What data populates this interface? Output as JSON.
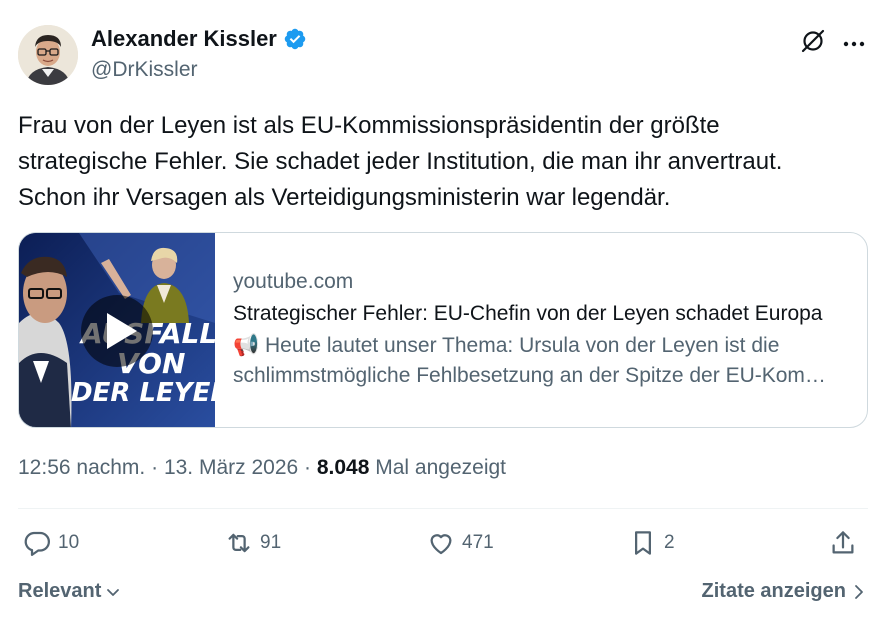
{
  "author": {
    "name": "Alexander Kissler",
    "handle": "@DrKissler",
    "verified_color": "#1d9bf0"
  },
  "tweet": {
    "lines": [
      "Frau von der Leyen ist als EU-Kommissionspräsidentin der größte",
      "strategische Fehler. Sie schadet jeder Institution, die man ihr anvertraut.",
      "Schon ihr Versagen als Verteidigungsministerin war legendär."
    ]
  },
  "card": {
    "domain": "youtube.com",
    "title": "Strategischer Fehler: EU-Chefin von der Leyen schadet Europa",
    "desc_line1": "📢 Heute lautet unser Thema: Ursula von der Leyen ist die",
    "desc_line2": "schlimmstmögliche Fehlbesetzung an der Spitze der EU-Kommission",
    "thumb_text_1": "AUSFALL",
    "thumb_text_2": "VON",
    "thumb_text_3": "DER LEYEN"
  },
  "meta": {
    "time": "12:56 nachm.",
    "sep1": " · ",
    "date": "13. März 2026",
    "sep2": " · ",
    "views": "8.048",
    "views_label": " Mal angezeigt"
  },
  "actions": {
    "replies": "10",
    "reposts": "91",
    "likes": "471",
    "bookmarks": "2"
  },
  "footer": {
    "sort_label": "Relevant",
    "quotes_label": "Zitate anzeigen"
  },
  "icons": {
    "grok": "grok-icon",
    "more": "more-icon",
    "reply": "reply-icon",
    "repost": "repost-icon",
    "like": "like-icon",
    "bookmark": "bookmark-icon",
    "share": "share-icon"
  },
  "colors": {
    "text": "#0f1419",
    "secondary": "#536471",
    "border": "#cfd9de",
    "accent": "#1d9bf0"
  }
}
